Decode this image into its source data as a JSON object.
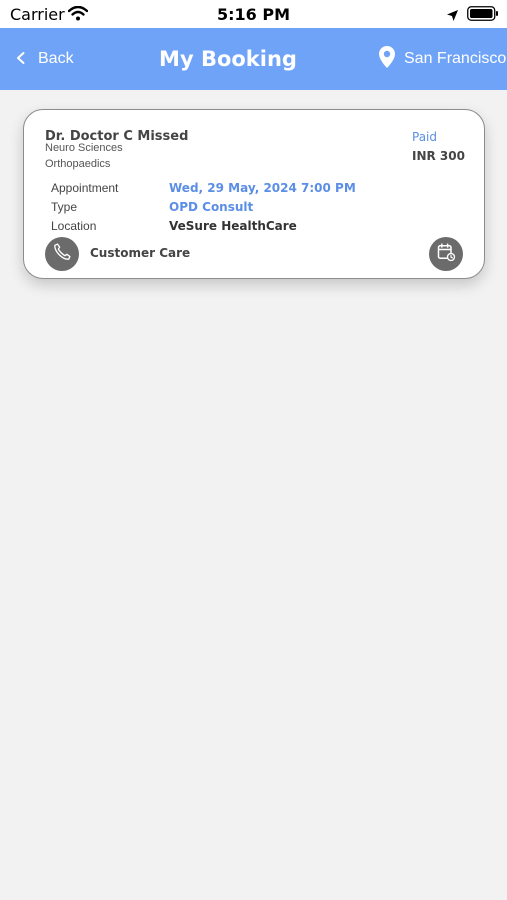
{
  "status_bar": {
    "carrier": "Carrier",
    "time": "5:16 PM"
  },
  "nav": {
    "back_label": "Back",
    "title": "My Booking",
    "location": "San Francisco"
  },
  "booking": {
    "doctor": "Dr. Doctor C Missed",
    "department": "Neuro Sciences",
    "specialty": "Orthopaedics",
    "payment_status": "Paid",
    "amount": "INR 300",
    "details": [
      {
        "label": "Appointment",
        "value": "Wed, 29 May, 2024 7:00 PM"
      },
      {
        "label": "Type",
        "value": "OPD Consult"
      },
      {
        "label": "Location",
        "value": "VeSure HealthCare"
      }
    ],
    "customer_care_label": "Customer Care"
  },
  "colors": {
    "nav_background": "#6fa3f7",
    "accent_blue": "#5b8ee6",
    "page_background": "#f2f2f2",
    "icon_circle": "#6b6b6b"
  },
  "icons": {
    "wifi": "wifi-icon",
    "location_arrow": "location-arrow-icon",
    "battery": "battery-icon",
    "back": "chevron-left-icon",
    "pin": "map-pin-icon",
    "call": "phone-icon",
    "reschedule": "calendar-reschedule-icon"
  }
}
